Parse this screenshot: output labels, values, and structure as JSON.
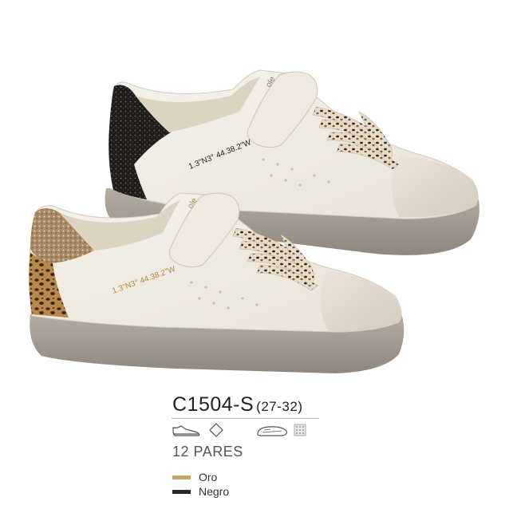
{
  "product": {
    "code": "C1504-S",
    "sizes": "(27-32)",
    "pairs": "12 PARES",
    "print_on_shoe": "1.3\"N3° 44.38.2\"W"
  },
  "icons": [
    "sneaker-icon",
    "diamond-icon",
    "sole-icon",
    "texture-icon"
  ],
  "colors": [
    {
      "label": "Oro",
      "hex": "#c9a565"
    },
    {
      "label": "Negro",
      "hex": "#2a2623"
    }
  ]
}
